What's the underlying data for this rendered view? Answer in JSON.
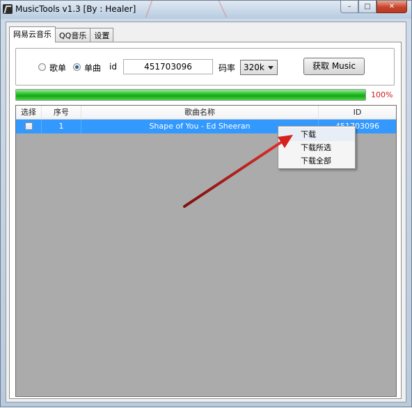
{
  "window": {
    "title": "MusicTools v1.3 [By : Healer]"
  },
  "tabs": [
    {
      "label": "网易云音乐",
      "active": true
    },
    {
      "label": "QQ音乐",
      "active": false
    },
    {
      "label": "设置",
      "active": false
    }
  ],
  "form": {
    "radio_playlist": "歌单",
    "radio_single": "单曲",
    "selected": "单曲",
    "id_label": "id",
    "id_value": "451703096",
    "bitrate_label": "码率",
    "bitrate_value": "320k",
    "fetch_button": "获取 Music"
  },
  "progress": {
    "value": 100,
    "text": "100%"
  },
  "table": {
    "columns": [
      "选择",
      "序号",
      "歌曲名称",
      "ID"
    ],
    "rows": [
      {
        "selected": false,
        "index": "1",
        "title": "Shape of You - Ed Sheeran",
        "id": "451703096"
      }
    ]
  },
  "context_menu": {
    "items": [
      "下载",
      "下载所选",
      "下载全部"
    ]
  },
  "colors": {
    "selection": "#3399ff",
    "progress": "#13a913",
    "percent": "#d01818",
    "annotation_arrow": "#c8201e"
  }
}
